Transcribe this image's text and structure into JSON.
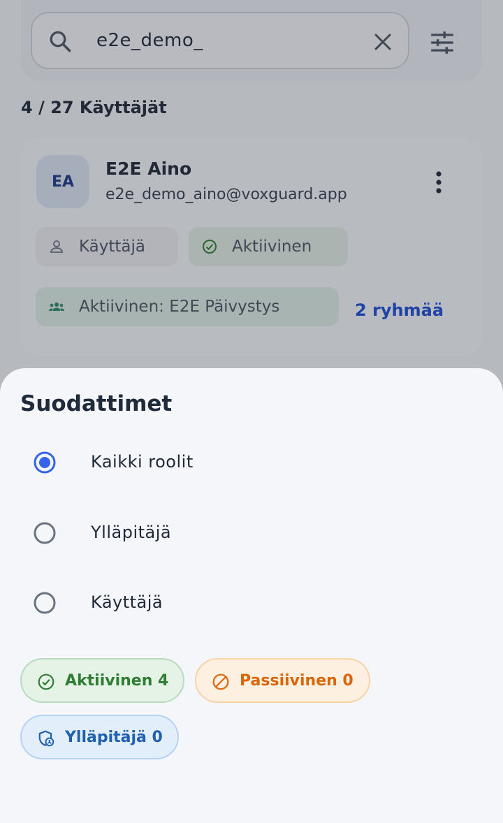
{
  "search": {
    "value": "e2e_demo_"
  },
  "results": {
    "count_text": "4 / 27 Käyttäjät"
  },
  "user_card": {
    "initials": "EA",
    "name": "E2E Aino",
    "email": "e2e_demo_aino@voxguard.app",
    "role_chip": "Käyttäjä",
    "status_chip": "Aktiivinen",
    "group_chip": "Aktiivinen: E2E Päivystys",
    "groups_link": "2 ryhmää"
  },
  "filters": {
    "title": "Suodattimet",
    "roles": [
      {
        "label": "Kaikki roolit",
        "selected": true
      },
      {
        "label": "Ylläpitäjä",
        "selected": false
      },
      {
        "label": "Käyttäjä",
        "selected": false
      }
    ],
    "status_pills": {
      "active": "Aktiivinen 4",
      "passive": "Passiivinen 0",
      "admin": "Ylläpitäjä 0"
    }
  },
  "colors": {
    "accent": "#3563e9",
    "active_green": "#2e7d32",
    "passive_orange": "#d9660b",
    "admin_blue": "#1f5fb0"
  }
}
